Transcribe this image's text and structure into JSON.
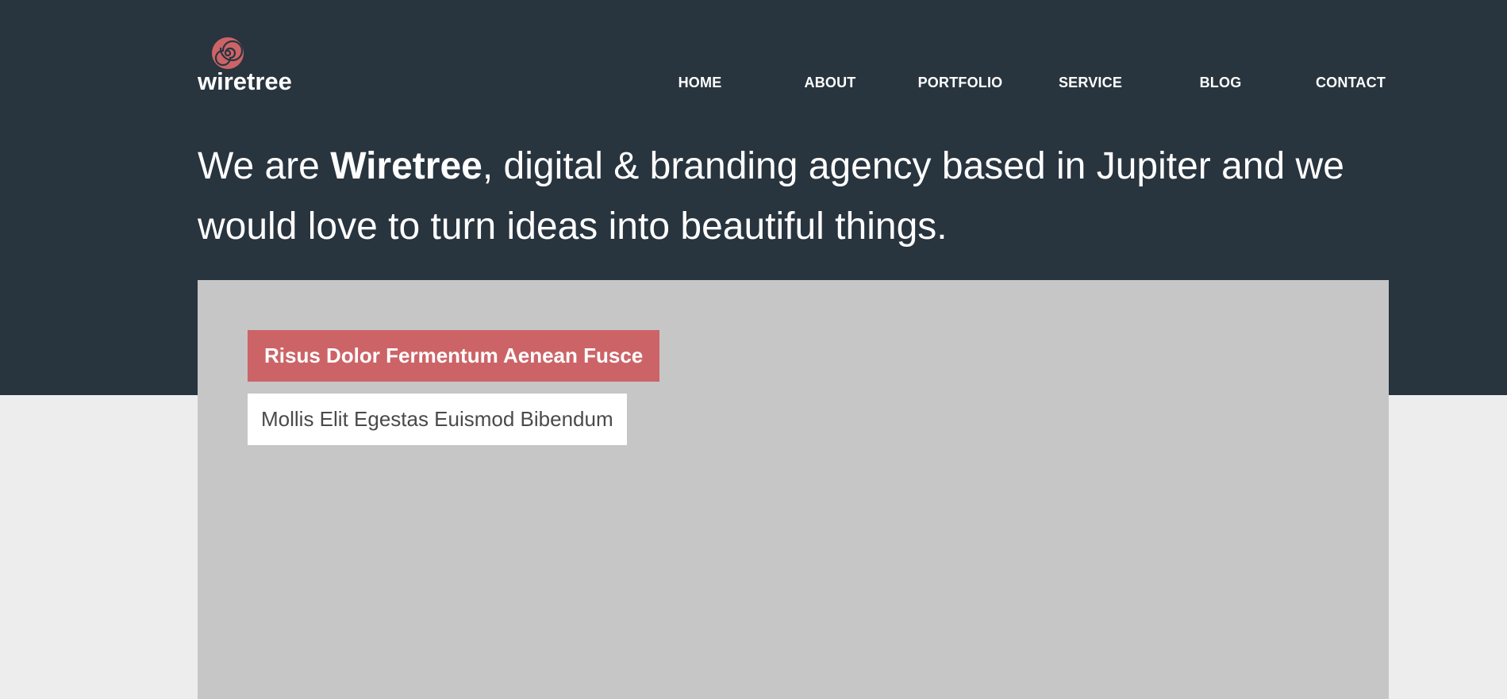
{
  "brand": {
    "name": "wiretree",
    "logo_color": "#cc6467"
  },
  "nav": {
    "items": [
      {
        "label": "HOME"
      },
      {
        "label": "ABOUT"
      },
      {
        "label": "PORTFOLIO"
      },
      {
        "label": "SERVICE"
      },
      {
        "label": "BLOG"
      },
      {
        "label": "CONTACT"
      }
    ]
  },
  "hero": {
    "prefix": "We are ",
    "brand": "Wiretree",
    "suffix": ", digital & branding agency based in Jupiter and we would love to turn ideas into beautiful things."
  },
  "feature": {
    "title": "Risus Dolor Fermentum Aenean Fusce",
    "subtitle": "Mollis Elit Egestas Euismod Bibendum"
  },
  "colors": {
    "header_bg": "#28343e",
    "page_bg": "#ededed",
    "panel_bg": "#c6c6c6",
    "accent": "#cc6467"
  }
}
